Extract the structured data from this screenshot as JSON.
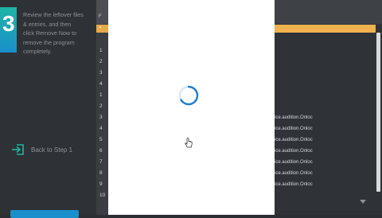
{
  "step": {
    "number": "3",
    "instruction": "Review the leftover files & entries, and then click Remove Now to remove the program completely.",
    "back_label": "Back to Step 1"
  },
  "table": {
    "header_label": "F",
    "rows": [
      "1",
      "2",
      "3",
      "4",
      "1",
      "2",
      "3",
      "4",
      "5",
      "6",
      "7",
      "8",
      "9",
      "10"
    ],
    "right_cells": [
      {
        "row": 4,
        "text": "ice.audition.Onloc"
      },
      {
        "row": 5,
        "text": "ice.audition.Onloc"
      },
      {
        "row": 6,
        "text": "ice.audition.Onloc"
      },
      {
        "row": 7,
        "text": "ice.audition.Onloc"
      },
      {
        "row": 8,
        "text": "ice.audition.Onloc"
      },
      {
        "row": 9,
        "text": "ice.audition.Onloc"
      },
      {
        "row": 10,
        "text": "ice.audition.Onloc"
      }
    ]
  },
  "colors": {
    "accent_teal": "#1fb4a6",
    "accent_blue": "#1a8fcb",
    "selected_row": "#f0b24e",
    "spinner": "#1a7fd0"
  },
  "icons": {
    "back": "exit-arrow-icon",
    "spinner": "loading-spinner-icon",
    "cursor": "hand-cursor-icon",
    "caret": "chevron-down-icon"
  }
}
